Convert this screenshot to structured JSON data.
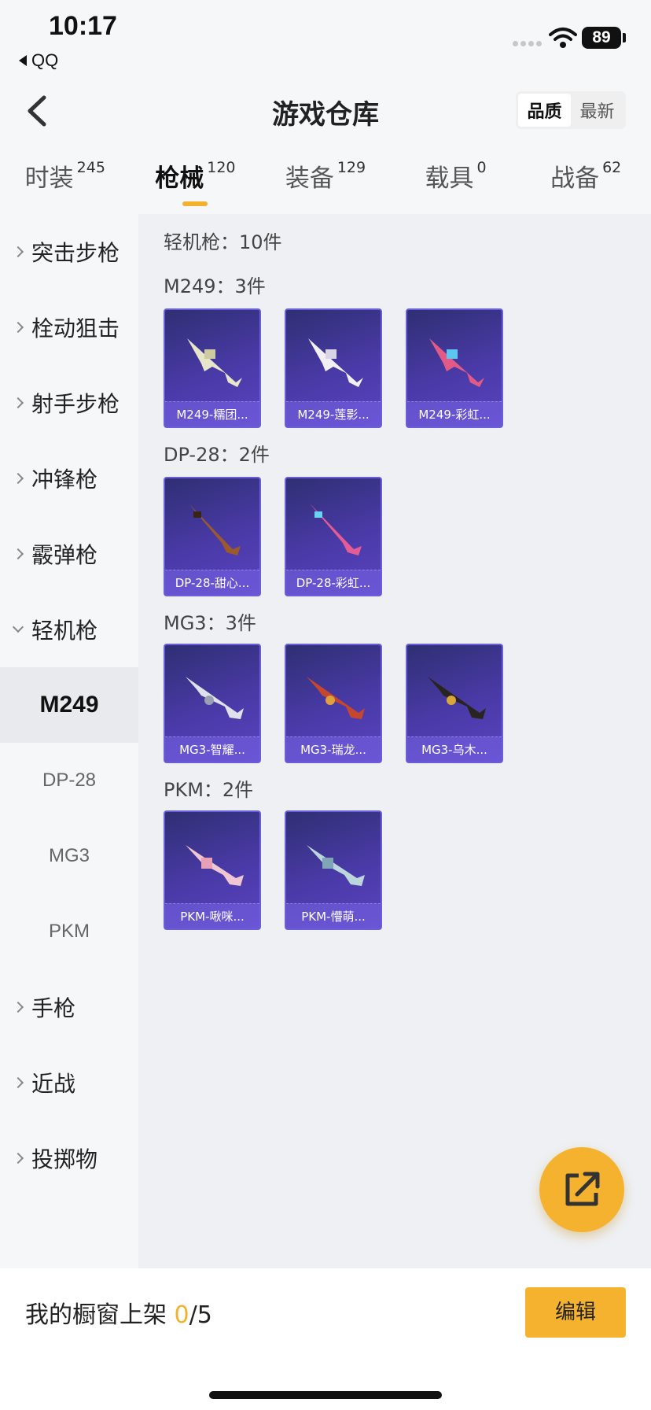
{
  "status_bar": {
    "time": "10:17",
    "back_app": "QQ",
    "battery": "89"
  },
  "header": {
    "title": "游戏仓库",
    "sort_options": [
      "品质",
      "最新"
    ],
    "sort_selected": "品质"
  },
  "tabs": [
    {
      "label": "时装",
      "count": "245"
    },
    {
      "label": "枪械",
      "count": "120",
      "active": true
    },
    {
      "label": "装备",
      "count": "129"
    },
    {
      "label": "载具",
      "count": "0"
    },
    {
      "label": "战备",
      "count": "62"
    }
  ],
  "sidebar": {
    "categories": [
      "突击步枪",
      "栓动狙击",
      "射手步枪",
      "冲锋枪",
      "霰弹枪",
      "轻机枪"
    ],
    "subcategories": [
      "M249",
      "DP-28",
      "MG3",
      "PKM"
    ],
    "after": [
      "手枪",
      "近战",
      "投掷物"
    ]
  },
  "content": {
    "summary": "轻机枪：10件",
    "groups": [
      {
        "title": "M249：3件",
        "items": [
          "M249-糯团...",
          "M249-莲影...",
          "M249-彩虹..."
        ]
      },
      {
        "title": "DP-28：2件",
        "items": [
          "DP-28-甜心...",
          "DP-28-彩虹..."
        ]
      },
      {
        "title": "MG3：3件",
        "items": [
          "MG3-智耀...",
          "MG3-瑞龙...",
          "MG3-乌木..."
        ]
      },
      {
        "title": "PKM：2件",
        "items": [
          "PKM-啾咪...",
          "PKM-懵萌..."
        ]
      }
    ]
  },
  "bottom": {
    "showcase_label": "我的橱窗上架",
    "showcase_count": "0",
    "showcase_total": "/5",
    "edit_label": "编辑"
  },
  "colors": {
    "accent": "#f2b22e",
    "card": "#4a3aa8"
  }
}
